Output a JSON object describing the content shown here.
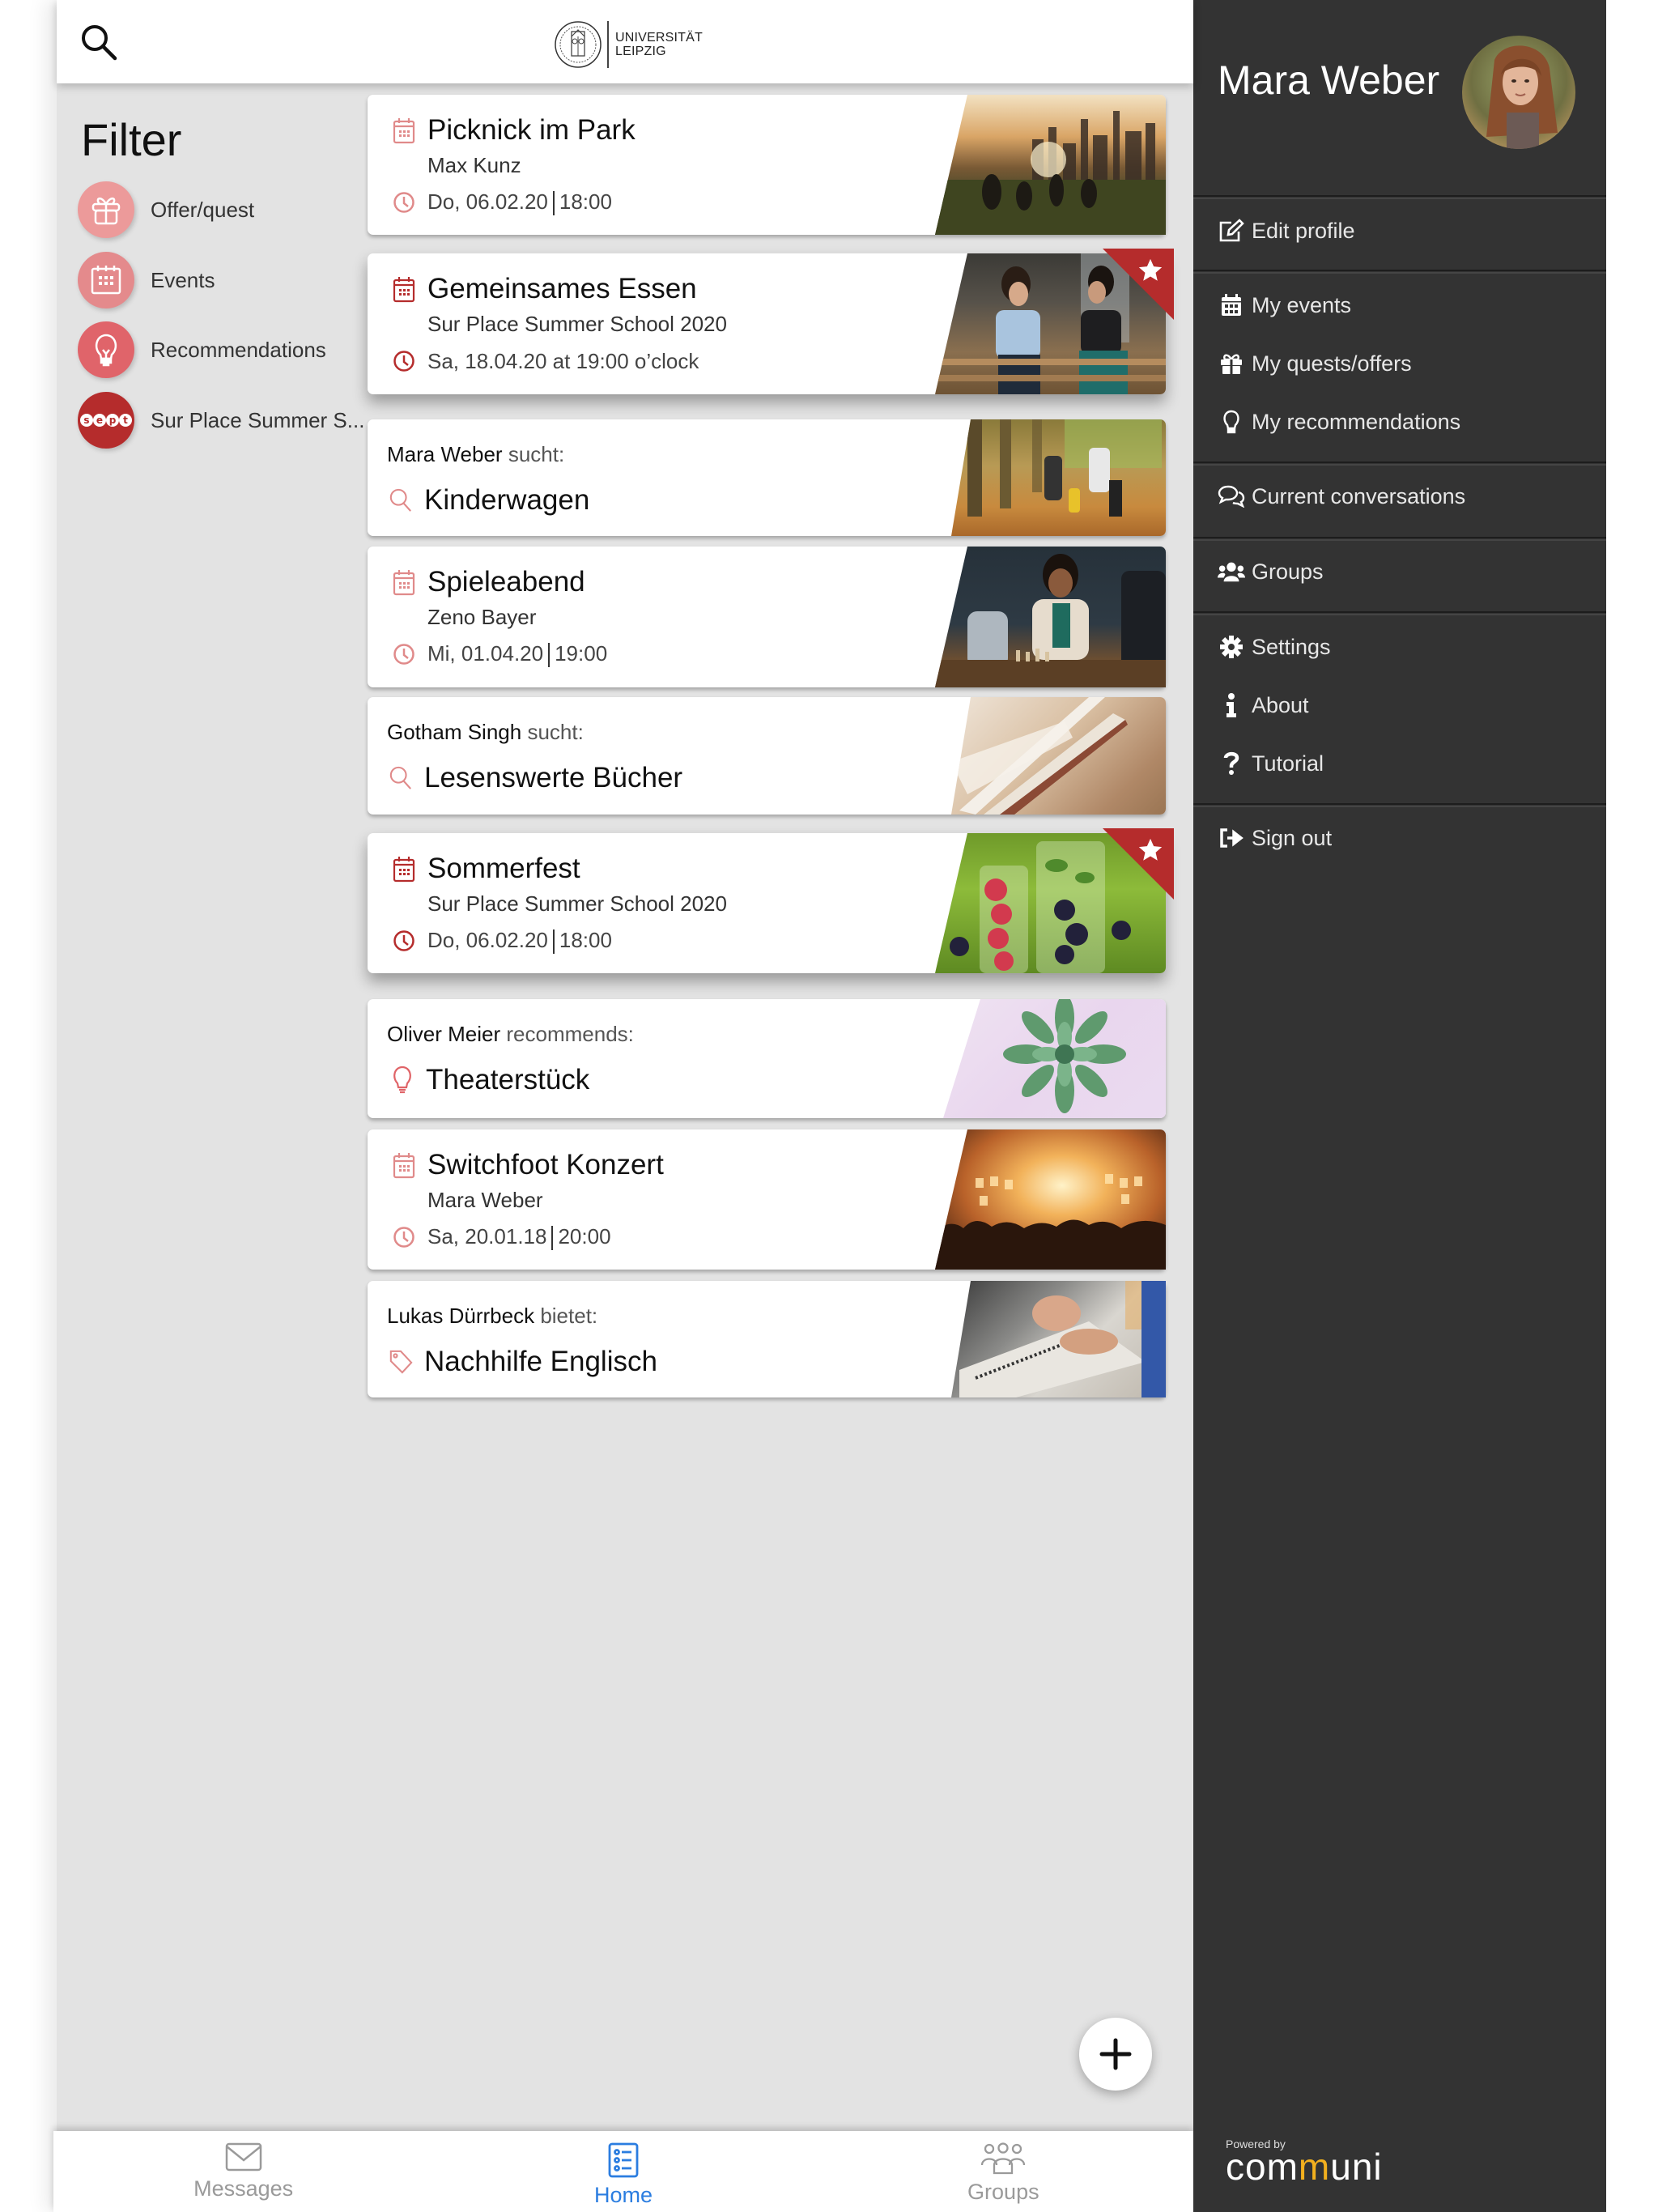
{
  "header": {
    "logo_line1": "UNIVERSITÄT",
    "logo_line2": "LEIPZIG"
  },
  "filter": {
    "title": "Filter",
    "items": [
      {
        "label": "Offer/quest",
        "icon": "gift-icon",
        "color": "#ec9a9a"
      },
      {
        "label": "Events",
        "icon": "calendar-icon",
        "color": "#e48a8c"
      },
      {
        "label": "Recommendations",
        "icon": "lightbulb-icon",
        "color": "#e0646a"
      },
      {
        "label": "Sur Place Summer S...",
        "icon": "sept-logo",
        "color": "#b52c2c",
        "logo_text": "sept"
      }
    ]
  },
  "feed": [
    {
      "type": "event",
      "title": "Picknick im Park",
      "subtitle": "Max Kunz",
      "date": "Do, 06.02.20",
      "time": "18:00",
      "featured": false
    },
    {
      "type": "event",
      "title": "Gemeinsames Essen",
      "subtitle": "Sur Place Summer School 2020",
      "date": "Sa, 18.04.20 at 19:00 o’clock",
      "time": "",
      "featured": true
    },
    {
      "type": "quest",
      "author": "Mara Weber",
      "verb": "sucht:",
      "title": "Kinderwagen"
    },
    {
      "type": "event",
      "title": "Spieleabend",
      "subtitle": "Zeno Bayer",
      "date": "Mi, 01.04.20",
      "time": "19:00",
      "featured": false
    },
    {
      "type": "quest",
      "author": "Gotham Singh",
      "verb": "sucht:",
      "title": "Lesenswerte Bücher"
    },
    {
      "type": "event",
      "title": "Sommerfest",
      "subtitle": "Sur Place Summer School 2020",
      "date": "Do, 06.02.20",
      "time": "18:00",
      "featured": true
    },
    {
      "type": "recommendation",
      "author": "Oliver Meier",
      "verb": "recommends:",
      "title": "Theaterstück"
    },
    {
      "type": "event",
      "title": "Switchfoot Konzert",
      "subtitle": "Mara Weber",
      "date": "Sa, 20.01.18",
      "time": "20:00",
      "featured": false
    },
    {
      "type": "offer",
      "author": "Lukas Dürrbeck",
      "verb": "bietet:",
      "title": "Nachhilfe Englisch"
    }
  ],
  "tabs": [
    {
      "label": "Messages",
      "icon": "envelope-icon",
      "active": false
    },
    {
      "label": "Home",
      "icon": "list-icon",
      "active": true
    },
    {
      "label": "Groups",
      "icon": "group-icon",
      "active": false
    }
  ],
  "sidebar": {
    "user_name": "Mara Weber",
    "menu": [
      {
        "label": "Edit profile",
        "icon": "edit-icon"
      },
      {
        "label": "My events",
        "icon": "calendar-icon"
      },
      {
        "label": "My quests/offers",
        "icon": "gift-icon"
      },
      {
        "label": "My recommendations",
        "icon": "lightbulb-icon"
      },
      {
        "label": "Current conversations",
        "icon": "chat-icon"
      },
      {
        "label": "Groups",
        "icon": "users-icon"
      },
      {
        "label": "Settings",
        "icon": "gear-icon"
      },
      {
        "label": "About",
        "icon": "info-icon"
      },
      {
        "label": "Tutorial",
        "icon": "question-icon"
      },
      {
        "label": "Sign out",
        "icon": "sign-out-icon"
      }
    ],
    "powered_by": "Powered by",
    "brand_pre": "com",
    "brand_m": "m",
    "brand_post": "uni"
  },
  "colors": {
    "accent": "#b52c2c",
    "accent_light": "#e08a8a",
    "active_tab": "#2b7de0",
    "sidebar_bg": "#333333",
    "app_bg": "#e3e3e3",
    "brand_yellow": "#f2b01e"
  }
}
